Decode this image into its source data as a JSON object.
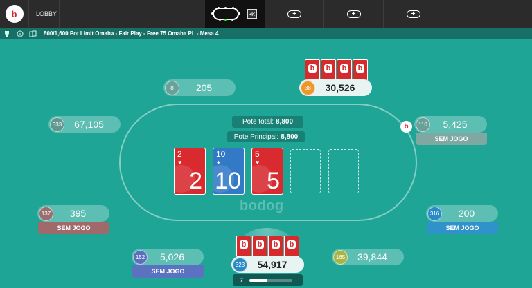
{
  "topbar": {
    "logo_letter": "b",
    "lobby_label": "LOBBY",
    "add_table_symbol": "+",
    "active_tab_icon": "table-icon",
    "quick_icon": "≪"
  },
  "infobar": {
    "icons": [
      "trophy-icon",
      "info-icon",
      "cards-icon"
    ],
    "table_name": "800/1,600 Pot Limit Omaha - Fair Play - Free 75 Omaha PL - Mesa 4"
  },
  "pot": {
    "total_label": "Pote total:",
    "total_value": "8,800",
    "main_label": "Pote Principal:",
    "main_value": "8,800"
  },
  "board": [
    {
      "rank": "2",
      "suit": "♥",
      "color": "red"
    },
    {
      "rank": "10",
      "suit": "♦",
      "color": "blue"
    },
    {
      "rank": "5",
      "suit": "♥",
      "color": "red"
    }
  ],
  "watermark": "bodog",
  "dealer_letter": "b",
  "seats": {
    "top_left": {
      "num": "8",
      "stack": "205",
      "num_color": "#6aa29a"
    },
    "top_right": {
      "num": "38",
      "stack": "30,526",
      "num_color": "#f0952a",
      "hole_cards": [
        "b",
        "b",
        "b",
        "b"
      ]
    },
    "left": {
      "num": "333",
      "stack": "67,105",
      "num_color": "#5f9890"
    },
    "right": {
      "num": "110",
      "stack": "5,425",
      "num_color": "#6ba09a",
      "status": "SEM JOGO",
      "status_color": "#7fa8a2"
    },
    "lower_left": {
      "num": "137",
      "stack": "395",
      "num_color": "#9b6e6e",
      "status": "SEM JOGO",
      "status_color": "#a06a6a"
    },
    "lower_right": {
      "num": "316",
      "stack": "200",
      "num_color": "#2a8ac6",
      "status": "SEM JOGO",
      "status_color": "#2f93c9"
    },
    "bottom_left": {
      "num": "152",
      "stack": "5,026",
      "num_color": "#5b6fbf",
      "status": "SEM JOGO",
      "status_color": "#5b72c1"
    },
    "bottom_right": {
      "num": "165",
      "stack": "39,844",
      "num_color": "#a8b542"
    },
    "hero": {
      "num": "323",
      "stack": "54,917",
      "num_color": "#2a8ac6",
      "hole_cards": [
        "b",
        "b",
        "b",
        "b"
      ],
      "timer": "7",
      "timer_progress": 0.42
    }
  }
}
